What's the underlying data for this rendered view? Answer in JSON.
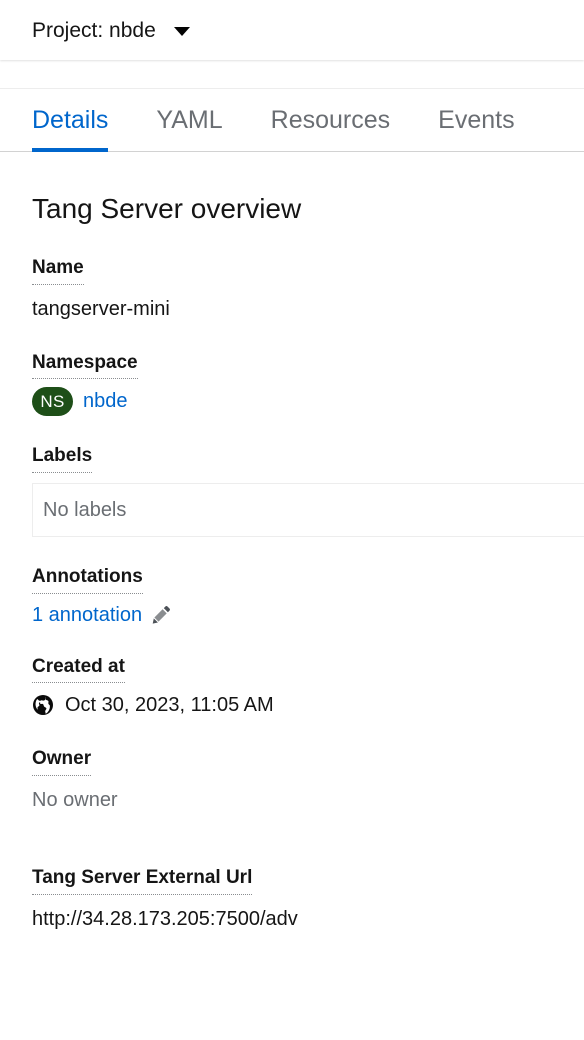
{
  "project_bar": {
    "label": "Project: nbde",
    "caret_icon": "chevron-down-icon"
  },
  "tabs": [
    {
      "label": "Details",
      "active": true
    },
    {
      "label": "YAML",
      "active": false
    },
    {
      "label": "Resources",
      "active": false
    },
    {
      "label": "Events",
      "active": false
    }
  ],
  "page": {
    "heading": "Tang Server overview"
  },
  "fields": {
    "name": {
      "label": "Name",
      "value": "tangserver-mini"
    },
    "namespace": {
      "label": "Namespace",
      "badge": "NS",
      "value": "nbde"
    },
    "labels": {
      "label": "Labels",
      "empty_text": "No labels"
    },
    "annotations": {
      "label": "Annotations",
      "value": "1 annotation",
      "edit_icon": "pencil-icon"
    },
    "created_at": {
      "label": "Created at",
      "icon": "globe-icon",
      "value": "Oct 30, 2023, 11:05 AM"
    },
    "owner": {
      "label": "Owner",
      "value": "No owner"
    },
    "external_url": {
      "label": "Tang Server External Url",
      "value": "http://34.28.173.205:7500/adv"
    }
  },
  "colors": {
    "accent_blue": "#0066CC",
    "namespace_badge_green": "#1E4F18",
    "muted_text": "#6A6E73",
    "text": "#151515"
  }
}
